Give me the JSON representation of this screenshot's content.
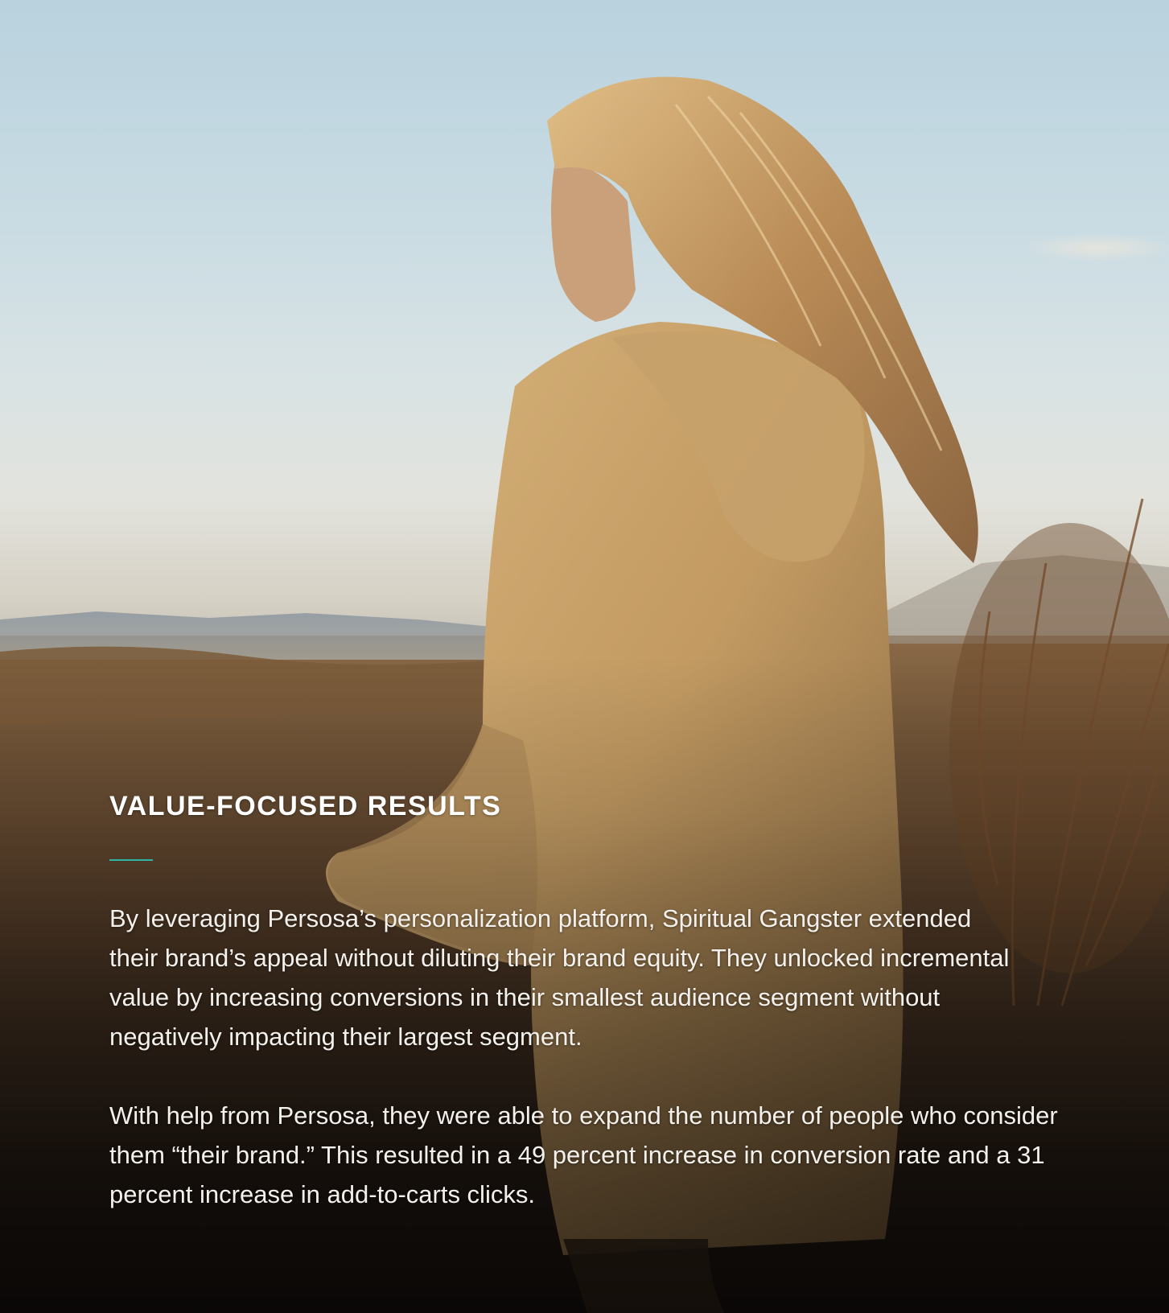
{
  "section": {
    "title": "VALUE-FOCUSED RESULTS",
    "accent_color": "#2fb5a4"
  },
  "paragraphs": [
    "By leveraging Persosa’s personalization platform, Spiritual Gangster extended their brand’s appeal without diluting their brand equity. They unlocked incremental value by increasing conversions in their smallest audience segment without negatively impacting their largest segment.",
    "With help from Persosa, they were able to expand the number of people who consider them “their brand.” This resulted in a 49 percent increase in conversion rate and a 31 percent increase in add-to-carts clicks."
  ],
  "photo": {
    "subject": "woman in hoodie walking in desert at sunset",
    "colors": {
      "sky": "#c8dbe3",
      "hoodie": "#c9a26a",
      "hair": "#c79a5e",
      "ground": "#5a412b"
    }
  }
}
